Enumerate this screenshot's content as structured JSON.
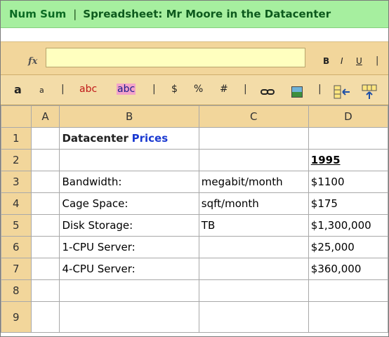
{
  "app": {
    "name": "Num Sum",
    "separator": "|",
    "title": "Spreadsheet: Mr Moore in the Datacenter"
  },
  "formula_bar": {
    "fx_label": "fx",
    "value": "",
    "bold_label": "B",
    "italic_label": "I",
    "underline_label": "U",
    "pipe": "|"
  },
  "toolbar": {
    "font_bigger_label": "a",
    "font_smaller_label": "a",
    "sep": "|",
    "text_color_label": "abc",
    "bg_color_label": "abc",
    "text_color": "#c01818",
    "bg_color": "#f3a3c9",
    "currency_label": "$",
    "percent_label": "%",
    "number_label": "#",
    "icons": [
      "link-icon",
      "insert-image-icon",
      "insert-column-icon",
      "insert-row-icon"
    ]
  },
  "sheet": {
    "columns": [
      "A",
      "B",
      "C",
      "D"
    ],
    "row_numbers": [
      "1",
      "2",
      "3",
      "4",
      "5",
      "6",
      "7",
      "8",
      "9"
    ],
    "b1_part1": "Datacenter",
    "b1_part2": "Prices",
    "year": "1995",
    "items": [
      {
        "label": "Bandwidth:",
        "unit": "megabit/month",
        "price": "$1100"
      },
      {
        "label": "Cage Space:",
        "unit": "sqft/month",
        "price": "$175"
      },
      {
        "label": "Disk Storage:",
        "unit": "TB",
        "price": "$1,300,000"
      },
      {
        "label": "1-CPU Server:",
        "unit": "",
        "price": "$25,000"
      },
      {
        "label": "4-CPU Server:",
        "unit": "",
        "price": "$360,000"
      }
    ]
  },
  "colors": {
    "title_bar": "#a6ef9f",
    "brand_text": "#0b6b23",
    "header_bg": "#f2d69b",
    "formula_input_bg": "#ffffbf",
    "accent_text": "#1b3ad1"
  }
}
